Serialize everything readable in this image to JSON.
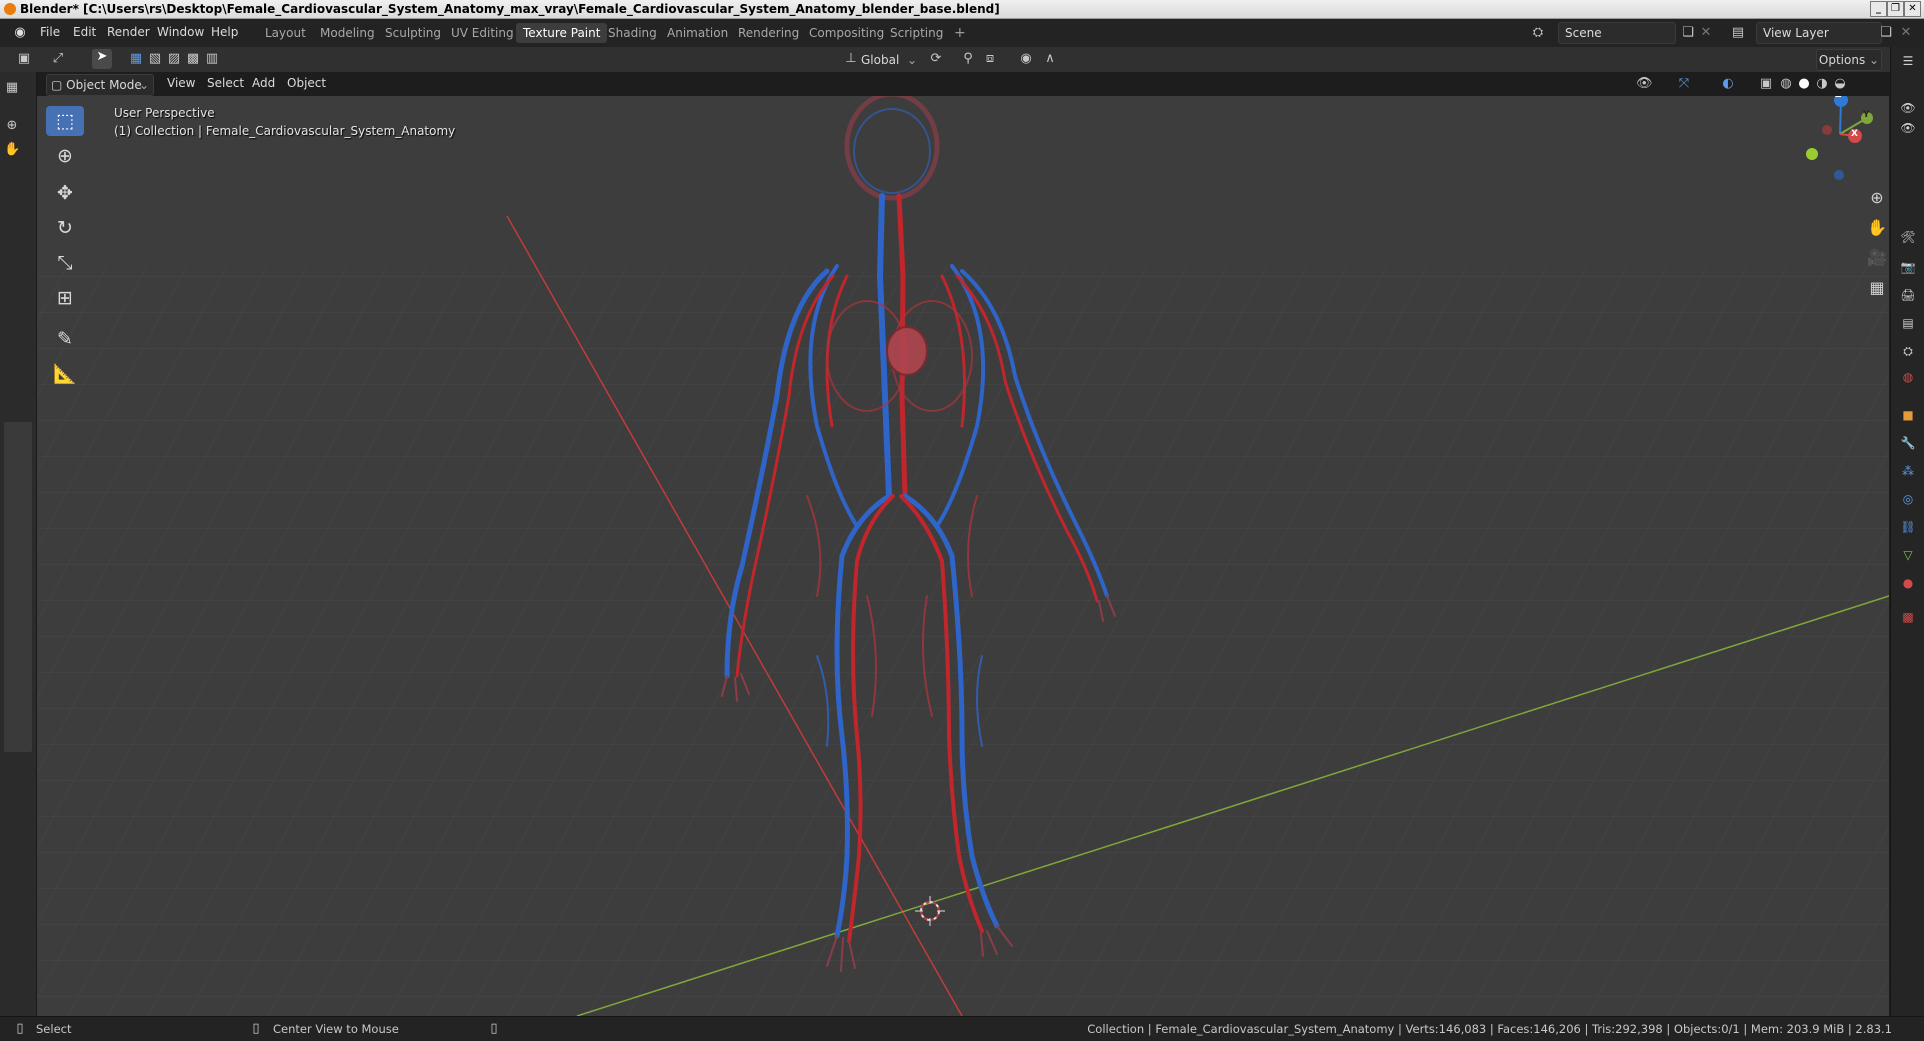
{
  "window": {
    "title": "Blender* [C:\\Users\\rs\\Desktop\\Female_Cardiovascular_System_Anatomy_max_vray\\Female_Cardiovascular_System_Anatomy_blender_base.blend]",
    "controls": [
      "_",
      "❐",
      "✕"
    ]
  },
  "menubar": {
    "items": [
      "File",
      "Edit",
      "Render",
      "Window",
      "Help"
    ]
  },
  "workspaces": {
    "tabs": [
      "Layout",
      "Modeling",
      "Sculpting",
      "UV Editing",
      "Texture Paint",
      "Shading",
      "Animation",
      "Rendering",
      "Compositing",
      "Scripting"
    ],
    "active": "Texture Paint",
    "add": "+"
  },
  "scene": {
    "label": "Scene"
  },
  "view_layer": {
    "label": "View Layer"
  },
  "tool_header": {
    "orientation": "Global",
    "options": "Options"
  },
  "view_header": {
    "mode": "Object Mode",
    "menus": [
      "View",
      "Select",
      "Add",
      "Object"
    ]
  },
  "viewport": {
    "perspective": "User Perspective",
    "collection": "(1) Collection | Female_Cardiovascular_System_Anatomy",
    "gizmo": {
      "z": "Z",
      "y": "Y",
      "x": "X"
    },
    "colors": {
      "bg": "#3d3d3d",
      "grid": "#4a4a4a",
      "x_axis": "#c23b3b",
      "y_axis": "#7ea83a",
      "artery": "#c0262c",
      "vein": "#2f64c8",
      "active_tool": "#4672b5"
    }
  },
  "toolbar": {
    "tools": [
      "select-box-icon",
      "cursor-icon",
      "move-icon",
      "rotate-icon",
      "scale-icon",
      "transform-icon",
      "annotate-icon",
      "measure-icon"
    ]
  },
  "statusbar": {
    "select": "Select",
    "center": "Center View to Mouse",
    "stats": "Collection | Female_Cardiovascular_System_Anatomy | Verts:146,083 | Faces:146,206 | Tris:292,398 | Objects:0/1 | Mem: 203.9 MiB | 2.83.1"
  }
}
